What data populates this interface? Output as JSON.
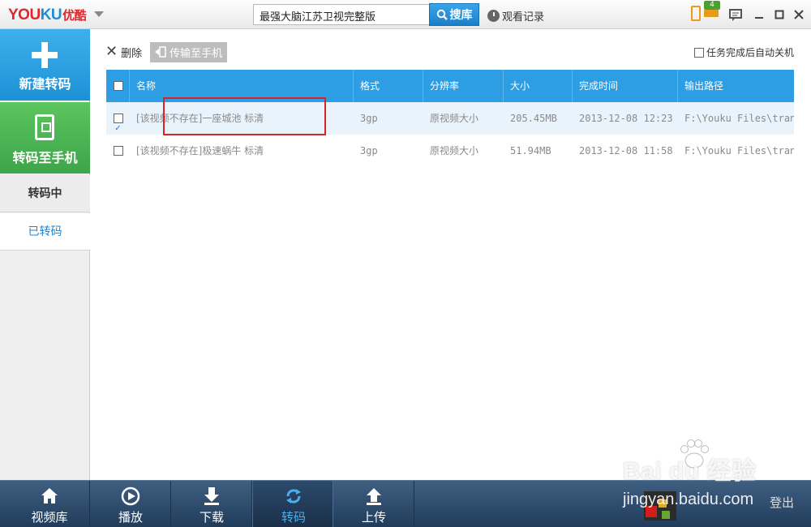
{
  "app": {
    "logo_you": "YOU",
    "logo_ku": "KU",
    "logo_cn": "优酷"
  },
  "search": {
    "value": "最强大脑江苏卫视完整版",
    "button_label": "搜库"
  },
  "topbar": {
    "history_label": "观看记录",
    "device_count": "4"
  },
  "sidebar": {
    "new_label": "新建转码",
    "to_phone_label": "转码至手机",
    "tabs": [
      {
        "label": "转码中"
      },
      {
        "label": "已转码"
      }
    ]
  },
  "toolbar": {
    "delete_label": "删除",
    "transfer_label": "传输至手机",
    "auto_shutdown_label": "任务完成后自动关机"
  },
  "table": {
    "headers": [
      "名称",
      "格式",
      "分辨率",
      "大小",
      "完成时间",
      "输出路径"
    ],
    "rows": [
      {
        "checked": true,
        "name": "[该视频不存在]一座城池 标清",
        "format": "3gp",
        "resolution": "原视频大小",
        "size": "205.45MB",
        "time": "2013-12-08 12:23",
        "path": "F:\\Youku Files\\trans"
      },
      {
        "checked": false,
        "name": "[该视频不存在]极速蜗牛 标清",
        "format": "3gp",
        "resolution": "原视频大小",
        "size": "51.94MB",
        "time": "2013-12-08 11:58",
        "path": "F:\\Youku Files\\trans"
      }
    ]
  },
  "bottom_nav": {
    "items": [
      {
        "label": "视频库",
        "icon": "house-icon"
      },
      {
        "label": "播放",
        "icon": "play-icon"
      },
      {
        "label": "下载",
        "icon": "download-icon"
      },
      {
        "label": "转码",
        "icon": "refresh-icon"
      },
      {
        "label": "上传",
        "icon": "upload-icon"
      }
    ],
    "active_index": 3,
    "login_label": "登出"
  },
  "watermark": {
    "brand": "Bai du 经验",
    "url": "jingyan.baidu.com"
  },
  "colors": {
    "header_blue": "#2d9ee3",
    "new_button_blue": "#1e91d6",
    "phone_button_green": "#3da54a",
    "highlight_red": "#d62626",
    "bottom_bar": "#213c5b"
  }
}
